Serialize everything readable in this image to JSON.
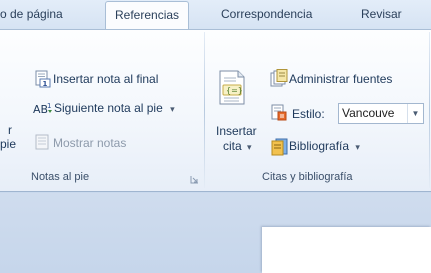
{
  "tabs": {
    "page_layout_partial": "o de página",
    "references": "Referencias",
    "mailings": "Correspondencia",
    "review": "Revisar"
  },
  "footnotes_group": {
    "insert_endnote": "Insertar nota al final",
    "next_footnote": "Siguiente nota al pie",
    "next_footnote_arrow": "▾",
    "show_notes": "Mostrar notas",
    "insert_footnote_partial_1": "r",
    "insert_footnote_partial_2": "pie",
    "label": "Notas al pie"
  },
  "citations_group": {
    "insert_citation_line1": "Insertar",
    "insert_citation_line2": "cita",
    "insert_citation_arrow": "▾",
    "manage_sources": "Administrar fuentes",
    "style_label": "Estilo:",
    "style_value": "Vancouve",
    "style_arrow": "▼",
    "bibliography": "Bibliografía",
    "bibliography_arrow": "▾",
    "label": "Citas y bibliografía"
  },
  "colors": {
    "ribbon_text": "#1e395b",
    "disabled_text": "#8d9aab",
    "backstage": "#c9d9ed"
  }
}
